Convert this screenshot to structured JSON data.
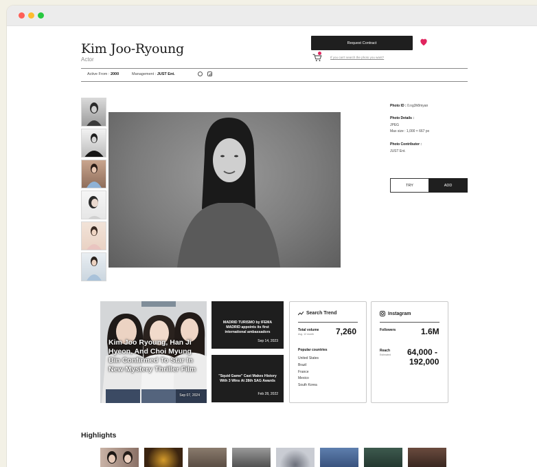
{
  "window": {
    "controls": [
      "close",
      "minimize",
      "maximize"
    ]
  },
  "profile": {
    "name": "Kim Joo-Ryoung",
    "role": "Actor"
  },
  "actions": {
    "request_contract": "Request Contract",
    "cant_find": "If you can't search the photo you want?",
    "try": "TRY",
    "add": "ADD"
  },
  "meta": {
    "active_from_label": "Active From :",
    "active_from_value": "2000",
    "management_label": "Management :",
    "management_value": "JUST Ent."
  },
  "photo_info": {
    "id_label": "Photo ID :",
    "id_value": "0.ng3h8myan",
    "details_label": "Photo Details :",
    "format": "JPEG",
    "max_size": "Max size : 1,000 × 667 px",
    "contributor_label": "Photo Contributor :",
    "contributor_value": "JUST Ent."
  },
  "news": {
    "featured_title": "Kim Joo Ryoung, Han Ji Hyeon, And Choi Myung Bin Confirmed To Star In New Mystery Thriller Film",
    "featured_date": "Sep 07, 2024",
    "card1_title": "MADRID TURISMO by IFEMA MADRID appoints its first international ambassadors",
    "card1_date": "Sep 14, 2023",
    "card2_title": "\"Squid Game\" Cast Makes History With 3 Wins At 28th SAG Awards",
    "card2_date": "Feb 28, 2022"
  },
  "search_trend": {
    "title": "Search Trend",
    "total_volume_label": "Total volume",
    "total_volume_sub": "Avg. 12 month",
    "total_volume_value": "7,260",
    "popular_label": "Popular countries",
    "countries": [
      "United States",
      "Brazil",
      "France",
      "Mexico",
      "South Korea"
    ]
  },
  "instagram": {
    "title": "Instagram",
    "followers_label": "Followers",
    "followers_value": "1.6M",
    "reach_label": "Reach",
    "reach_sub": "Estimated",
    "reach_value_1": "64,000 -",
    "reach_value_2": "192,000"
  },
  "highlights": {
    "title": "Highlights"
  },
  "icons": [
    "heart-icon",
    "cart-icon",
    "globe-icon",
    "instagram-icon",
    "trend-icon"
  ],
  "colors": {
    "accent": "#e0245e",
    "dark": "#1f1f1f"
  }
}
